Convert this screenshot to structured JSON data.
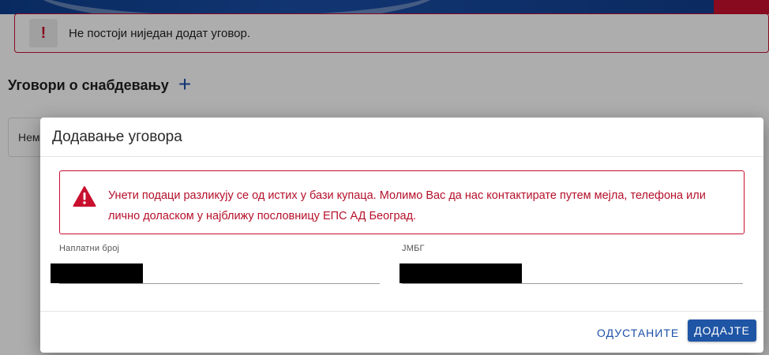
{
  "colors": {
    "brand_blue": "#1b4fa8",
    "error_red": "#c8102e",
    "error_text": "#b5102a"
  },
  "banner": {
    "icon": "exclamation-icon",
    "icon_glyph": "!",
    "message": "Не постоји ниједан додат уговор."
  },
  "section": {
    "title": "Уговори о снабдевању",
    "add_icon": "plus-icon",
    "add_glyph": "+"
  },
  "background_card": {
    "text": "Нем"
  },
  "dialog": {
    "title": "Додавање уговора",
    "error": {
      "icon": "warning-triangle-icon",
      "message": "Унети подаци разликују се од истих у бази купаца. Молимо Вас да нас контактирате путем мејла, телефона или лично доласком у најближу пословницу ЕПС АД Београд."
    },
    "fields": {
      "billing_number": {
        "label": "Наплатни број"
      },
      "jmbg": {
        "label": "ЈМБГ"
      }
    },
    "buttons": {
      "cancel": "ОДУСТАНИТЕ",
      "add": "ДОДАЈТЕ"
    }
  }
}
